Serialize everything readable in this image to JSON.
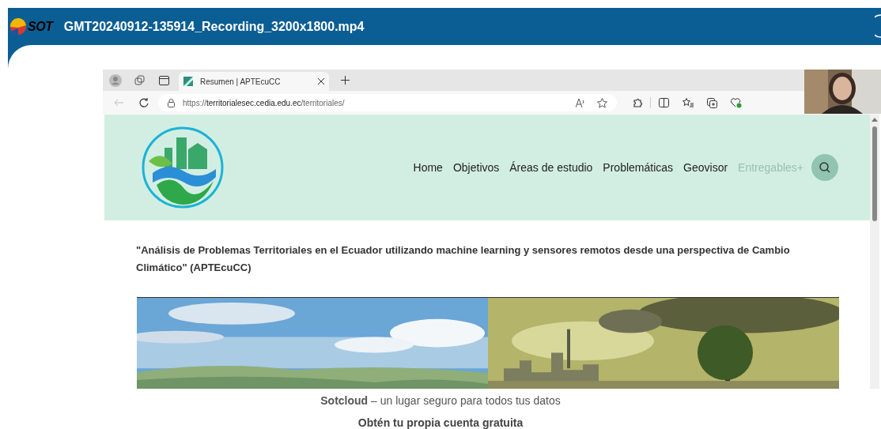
{
  "app_bar": {
    "logo_text": "SOT",
    "title": "GMT20240912-135914_Recording_3200x1800.mp4"
  },
  "browser": {
    "tab": {
      "title": "Resumen | APTEcuCC",
      "selected": true
    },
    "address": {
      "prefix": "https://",
      "host": "territorialesec.cedia.edu.ec",
      "path": "/territoriales/"
    }
  },
  "site": {
    "nav": [
      {
        "label": "Home",
        "disabled": false
      },
      {
        "label": "Objetivos",
        "disabled": false
      },
      {
        "label": "Áreas de estudio",
        "disabled": false
      },
      {
        "label": "Problemáticas",
        "disabled": false
      },
      {
        "label": "Geovisor",
        "disabled": false
      },
      {
        "label": "Entregables+",
        "disabled": true
      }
    ],
    "heading": "\"Análisis de Problemas Territoriales en el Ecuador utilizando machine learning y sensores remotos desde una perspectiva de Cambio Climático\" (APTEcuCC)"
  },
  "footer": {
    "line": "**Sotcloud** – un lugar seguro para todos tus datos",
    "cta": "Obtén tu propia cuenta gratuita"
  }
}
